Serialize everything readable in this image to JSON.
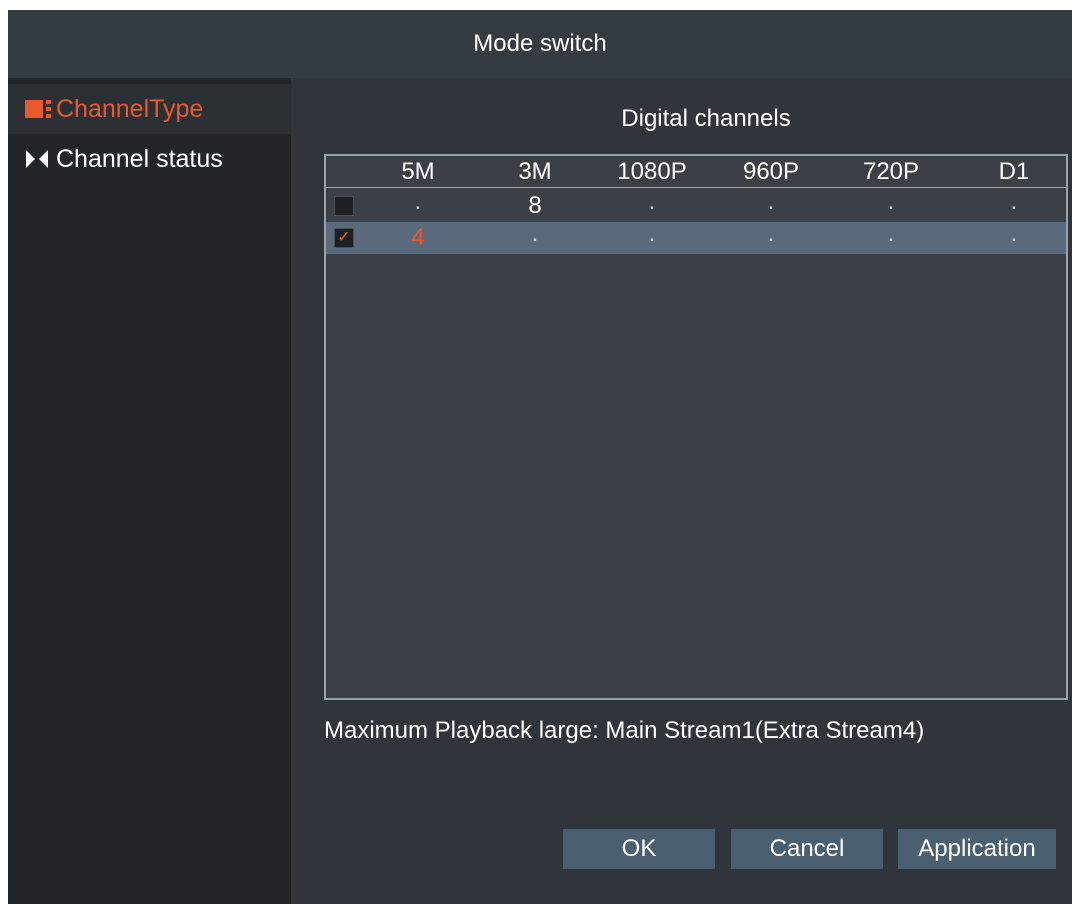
{
  "dialog": {
    "title": "Mode switch"
  },
  "sidebar": {
    "items": [
      {
        "label": "ChannelType",
        "icon": "channel-type-icon",
        "active": true
      },
      {
        "label": "Channel status",
        "icon": "channel-status-icon",
        "active": false
      }
    ]
  },
  "main": {
    "section_title": "Digital channels",
    "table": {
      "columns": [
        "5M",
        "3M",
        "1080P",
        "960P",
        "720P",
        "D1"
      ],
      "rows": [
        {
          "checked": false,
          "cells": [
            ".",
            "8",
            ".",
            ".",
            ".",
            "."
          ]
        },
        {
          "checked": true,
          "check_mark": "✓",
          "cells": [
            "4",
            ".",
            ".",
            ".",
            ".",
            "."
          ]
        }
      ]
    },
    "note": "Maximum Playback large: Main Stream1(Extra Stream4)"
  },
  "buttons": {
    "ok": "OK",
    "cancel": "Cancel",
    "apply": "Application"
  },
  "colors": {
    "accent": "#e8592d",
    "titlebar": "#343b41",
    "sidebar": "#222629",
    "panel": "#30343b",
    "selected_row": "#5a6a7c",
    "button": "#4a5f70"
  }
}
